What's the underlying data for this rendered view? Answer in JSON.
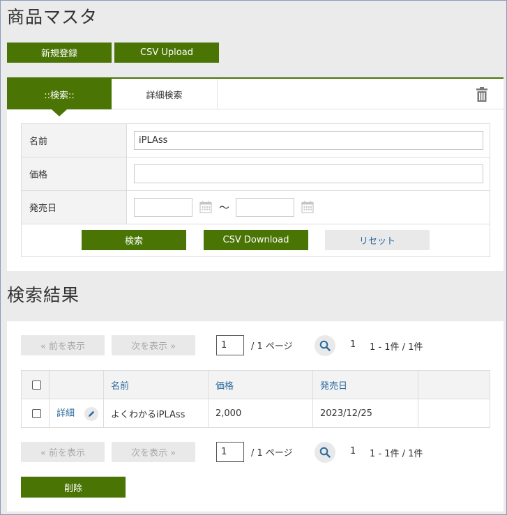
{
  "page_title": "商品マスタ",
  "top_actions": {
    "new_label": "新規登録",
    "upload_label": "CSV Upload"
  },
  "search": {
    "tab_simple": "::検索::",
    "tab_detail": "詳細検索",
    "fields": {
      "name_label": "名前",
      "name_value": "iPLAss",
      "price_label": "価格",
      "price_value": "",
      "date_label": "発売日",
      "date_from": "",
      "date_to": "",
      "tilde": "～"
    },
    "buttons": {
      "search": "検索",
      "csv_download": "CSV Download",
      "reset": "リセット"
    }
  },
  "results": {
    "title": "検索結果",
    "pager": {
      "prev": "« 前を表示",
      "next": "次を表示 »",
      "page_value": "1",
      "page_total": "/ 1 ページ",
      "current": "1",
      "range": "1 - 1件 / 1件"
    },
    "columns": [
      "名前",
      "価格",
      "発売日"
    ],
    "rows": [
      {
        "detail": "詳細",
        "name": "よくわかるiPLAss",
        "price": "2,000",
        "date": "2023/12/25"
      }
    ],
    "delete_label": "削除"
  },
  "colors": {
    "accent": "#4a7505",
    "link": "#2b6a9e",
    "panel_bg": "#ebebeb"
  },
  "icons": [
    "trash-icon",
    "calendar-icon",
    "search-icon",
    "pencil-icon"
  ]
}
